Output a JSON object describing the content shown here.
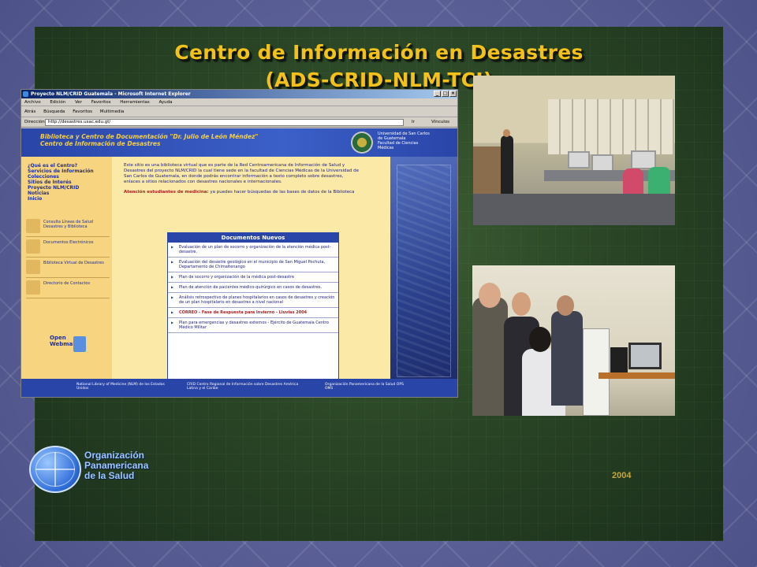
{
  "slide": {
    "title_line1": "Centro de Información en Desastres",
    "title_line2": "(ADS-CRID-NLM-TCI)",
    "year": "2004",
    "paho": {
      "line1": "Organización",
      "line2": "Panamericana",
      "line3": "de la Salud"
    }
  },
  "browser": {
    "window_title": "Proyecto NLM/CRID Guatemala - Microsoft Internet Explorer",
    "menu": [
      "Archivo",
      "Edición",
      "Ver",
      "Favoritos",
      "Herramientas",
      "Ayuda"
    ],
    "toolbar": [
      "Atrás",
      "Búsqueda",
      "Favoritos",
      "Multimedia"
    ],
    "address_label": "Dirección",
    "address": "http://desastres.usac.edu.gt/",
    "go_label": "Ir",
    "links_label": "Vínculos"
  },
  "site": {
    "header_line1": "Biblioteca y Centro de Documentación \"Dr. Julio de León Méndez\"",
    "header_line2": "Centro de Información de Desastres",
    "usac_lines": [
      "Universidad de San Carlos",
      "de Guatemala",
      "Facultad de Ciencias",
      "Médicas"
    ],
    "nav": [
      "¿Qué es el Centro?",
      "Servicios de Información",
      "Colecciones",
      "Sitios de Interés",
      "Proyecto NLM/CRID",
      "Noticias",
      "Inicio"
    ],
    "side_links": [
      "Consulta Líneas de Salud Desastres y Biblioteca",
      "Documentos Electrónicos",
      "Biblioteca Virtual de Desastres",
      "Directorio de Contactos"
    ],
    "webmail": "Open Webmail",
    "intro": "Este sitio es una biblioteca virtual que es parte de la Red Centroamericana de Información de Salud y Desastres del proyecto NLM/CRID la cual tiene sede en la facultad de Ciencias Médicas de la Universidad de San Carlos de Guatemala, en donde podrás encontrar información a texto completo sobre desastres, enlaces a sitios relacionados con desastres nacionales e internacionales.",
    "attention_label": "Atención estudiantes de medicina:",
    "attention_text": "ya puedes hacer búsquedas de las bases de datos de la Biblioteca",
    "docs_title": "Documentos Nuevos",
    "docs": [
      "Evaluación de un plan de socorro y organización de la atención médica post-desastre.",
      "Evaluación del desastre geológico en el municipio de San Miguel Pochuta, Departamento de Chimaltenango",
      "Plan de socorro y organización de la médica post-desastre",
      "Plan de atención de pacientes médico-quirúrgico en casos de desastres.",
      "Análisis retrospectivo de planes hospitalarios en casos de desastres y creación de un plan hospitalario en desastres a nivel nacional",
      "CORREO - Fase de Respuesta para Invierno - Lluvias 2004",
      "Plan para emergencias y desastres externos - Ejército de Guatemala Centro Médico Militar"
    ],
    "footer": [
      "National Library of Medicine (NLM) de los Estados Unidos",
      "CRID Centro Regional de Información sobre Desastres América Latina y el Caribe",
      "Organización Panamericana de la Salud OPS OMS"
    ]
  },
  "colors": {
    "title": "#f4c11a",
    "slide_bg": "#2a4626",
    "paho_text": "#9cc8ff"
  }
}
